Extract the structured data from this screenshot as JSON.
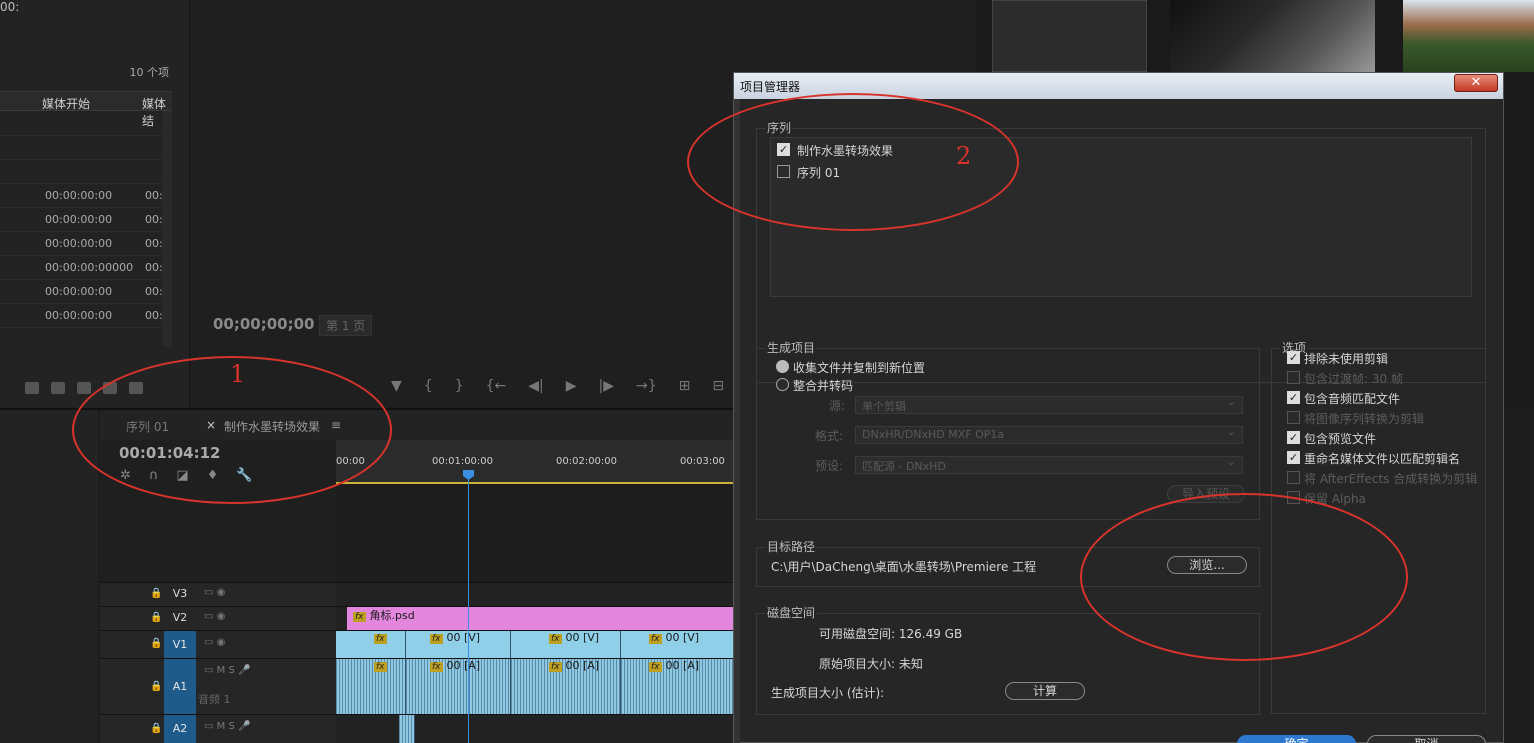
{
  "project_panel": {
    "item_count": "10 个项",
    "col_media_start": "媒体开始",
    "col_media_end": "媒体结",
    "rows": [
      {
        "start": "00:00:00:00",
        "end": "00:"
      },
      {
        "start": "00:00:00:00",
        "end": "00:"
      },
      {
        "start": "00:00:00:00",
        "end": "00:"
      },
      {
        "start": "00:00:00:00000",
        "end": "00:"
      },
      {
        "start": "00:00:00:00",
        "end": "00:"
      },
      {
        "start": "00:00:00:00",
        "end": "00:"
      }
    ]
  },
  "monitor": {
    "timecode": "00;00;00;00",
    "page": "第 1 页",
    "right_timecode": "00:"
  },
  "timeline": {
    "tab_seq01": "序列 01",
    "tab_close": "×",
    "tab_active": "制作水墨转场效果",
    "tab_menu": "≡",
    "timecode": "00:01:04:12",
    "ruler": [
      "00:00",
      "00:01:00:00",
      "00:02:00:00",
      "00:03:00"
    ],
    "tracks": [
      {
        "label": "V3"
      },
      {
        "label": "V2"
      },
      {
        "label": "V1"
      },
      {
        "label": "A1",
        "sub": "音频 1"
      },
      {
        "label": "A2"
      }
    ],
    "v2_clip": "角标.psd",
    "v1_clips": [
      "00 [V]",
      "00 [V]",
      "00 [V]"
    ],
    "a1_clips": [
      "00 [A]",
      "00 [A]",
      "00 [A]"
    ],
    "track_icons": {
      "m": "M",
      "s": "S"
    }
  },
  "dialog": {
    "title": "项目管理器",
    "close_label": "✕",
    "sequences_group": "序列",
    "sequences": [
      {
        "label": "制作水墨转场效果",
        "checked": true
      },
      {
        "label": "序列 01",
        "checked": false
      }
    ],
    "generate_group": "生成项目",
    "option_collect": "收集文件并复制到新位置",
    "option_consolidate": "整合并转码",
    "source_label": "源:",
    "source_value": "单个剪辑",
    "format_label": "格式:",
    "format_value": "DNxHR/DNxHD MXF OP1a",
    "preset_label": "预设:",
    "preset_value": "匹配源 - DNxHD",
    "import_preset": "导入预设",
    "options_group": "选项",
    "options": [
      {
        "label": "排除未使用剪辑",
        "checked": true,
        "enabled": true
      },
      {
        "label": "包含过渡帧:  30 帧",
        "checked": false,
        "enabled": false
      },
      {
        "label": "包含音频匹配文件",
        "checked": true,
        "enabled": true
      },
      {
        "label": "将图像序列转换为剪辑",
        "checked": false,
        "enabled": false
      },
      {
        "label": "包含预览文件",
        "checked": true,
        "enabled": true
      },
      {
        "label": "重命名媒体文件以匹配剪辑名",
        "checked": true,
        "enabled": true
      },
      {
        "label": "将 AfterEffects 合成转换为剪辑",
        "checked": false,
        "enabled": false
      },
      {
        "label": "保留 Alpha",
        "checked": false,
        "enabled": false
      }
    ],
    "target_group": "目标路径",
    "target_path": "C:\\用户\\DaCheng\\桌面\\水墨转场\\Premiere 工程",
    "browse_label": "浏览...",
    "disk_group": "磁盘空间",
    "available_label": "可用磁盘空间: 126.49 GB",
    "original_label": "原始项目大小: 未知",
    "estimate_label": "生成项目大小 (估计):",
    "calc_label": "计算",
    "ok_label": "确定",
    "cancel_label": "取消"
  },
  "annotations": {
    "label_1": "1",
    "label_2": "2",
    "color": "#d8342c"
  }
}
